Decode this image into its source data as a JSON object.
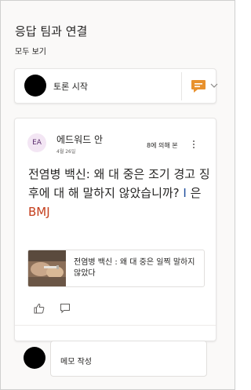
{
  "header": {
    "title": "응답 팀과 연결",
    "view_all": "모두 보기"
  },
  "start_discussion": {
    "label": "토론 시작"
  },
  "post": {
    "avatar_initials": "EA",
    "author": "에드워드 안",
    "date": "4월 26일",
    "meta": "8에 의해 본",
    "body_part1": "전염병 백신: 왜 대 중은 조기 경고 징후에 대 해 말하지 않았습니까? ",
    "body_mid": "I",
    "body_part2": " 은",
    "body_highlight": "BMJ",
    "link_title": "전염병 백신 : 왜 대 중은 일찍 말하지 않았다"
  },
  "comment": {
    "placeholder": "메모 작성"
  },
  "colors": {
    "accent_orange": "#e8912d",
    "highlight": "#c43e1c",
    "avatar_bg": "#f3e6f4"
  }
}
